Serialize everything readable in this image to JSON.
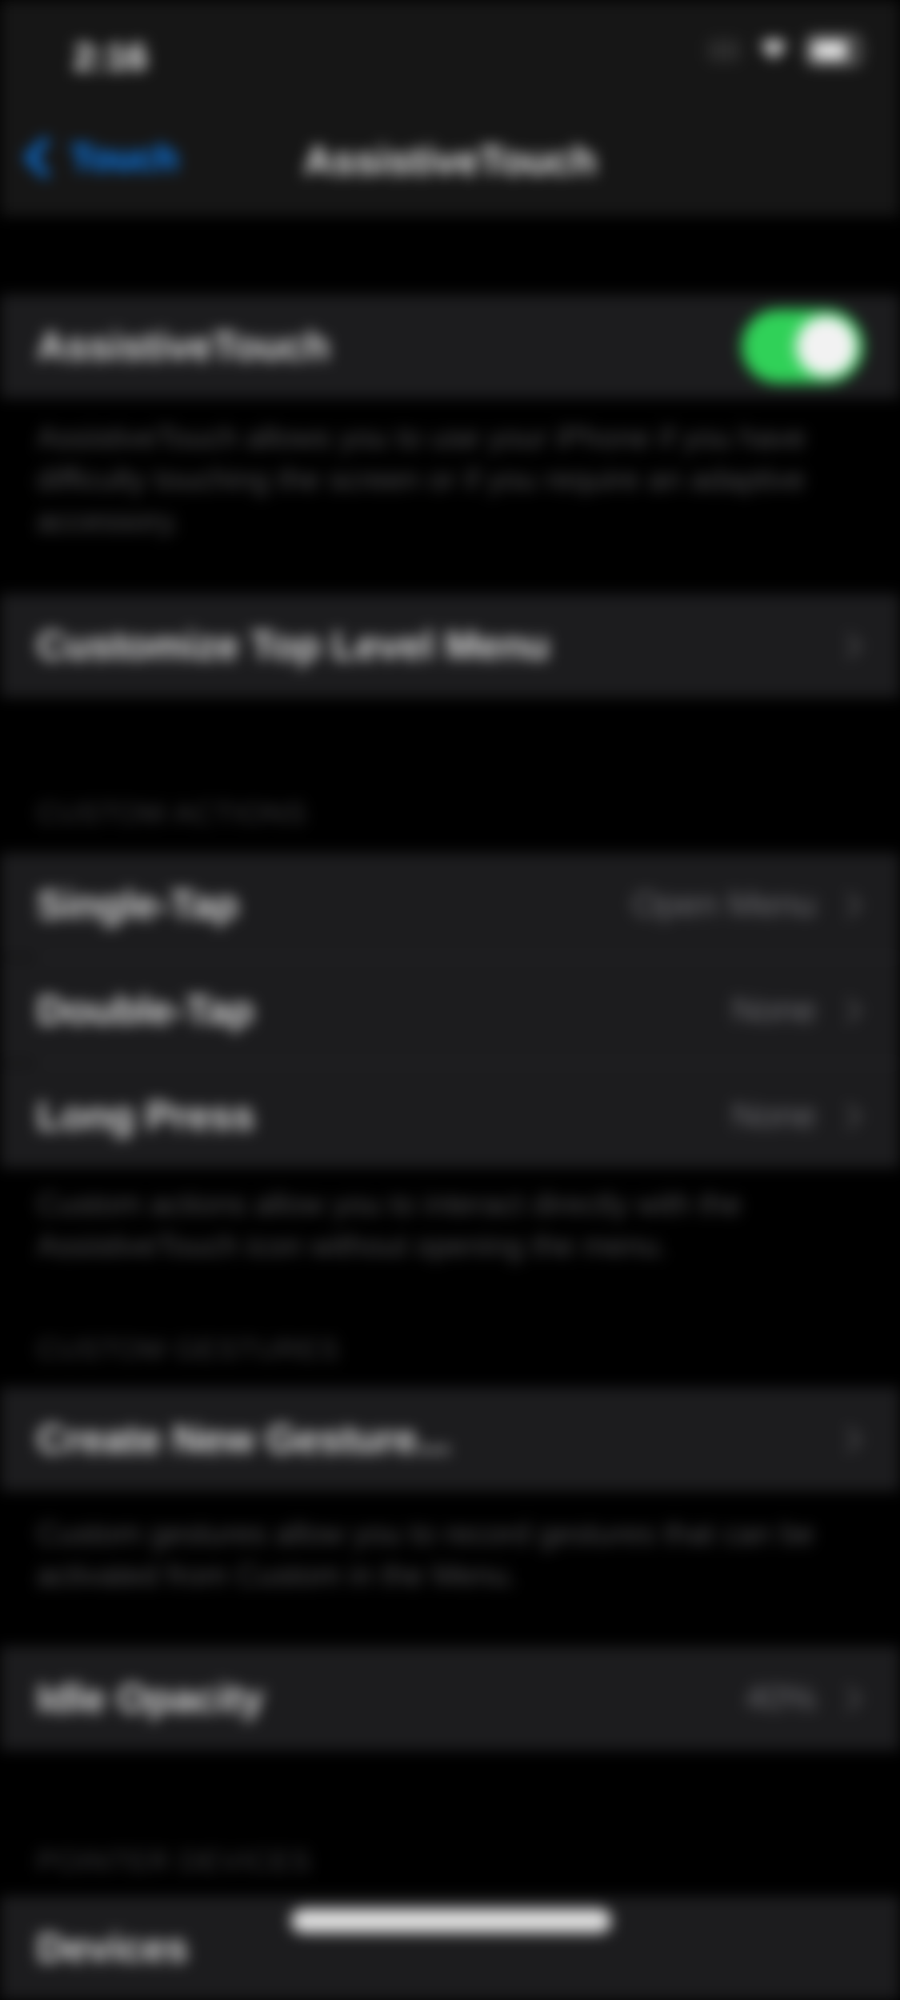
{
  "status_bar": {
    "time": "2:16",
    "icons": [
      "signal-icon",
      "wifi-icon",
      "battery-icon"
    ]
  },
  "nav": {
    "back_label": "Touch",
    "title": "AssistiveTouch"
  },
  "main_toggle": {
    "label": "AssistiveTouch",
    "on": true,
    "footer": "AssistiveTouch allows you to use your iPhone if you have difficulty touching the screen or if you require an adaptive accessory."
  },
  "customize": {
    "label": "Customize Top Level Menu"
  },
  "custom_actions": {
    "header": "CUSTOM ACTIONS",
    "items": [
      {
        "label": "Single-Tap",
        "value": "Open Menu"
      },
      {
        "label": "Double-Tap",
        "value": "None"
      },
      {
        "label": "Long Press",
        "value": "None"
      }
    ],
    "footer": "Custom actions allow you to interact directly with the AssistiveTouch icon without opening the menu."
  },
  "custom_gestures": {
    "header": "CUSTOM GESTURES",
    "create_label": "Create New Gesture...",
    "footer": "Custom gestures allow you to record gestures that can be activated from Custom in the Menu."
  },
  "idle_opacity": {
    "label": "Idle Opacity",
    "value": "40%"
  },
  "pointer_devices": {
    "header": "POINTER DEVICES",
    "first_item": "Devices"
  },
  "colors": {
    "accent": "#0a84ff",
    "toggle_on": "#30d158",
    "cell_bg": "#1c1c1e"
  }
}
